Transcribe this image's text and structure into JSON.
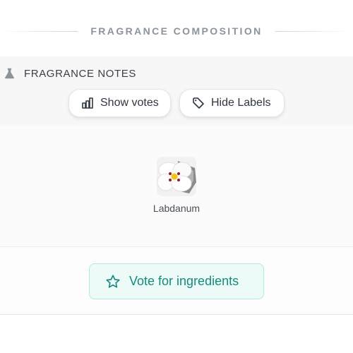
{
  "section": {
    "title": "FRAGRANCE COMPOSITION"
  },
  "notes": {
    "heading": "FRAGRANCE NOTES",
    "heading_icon": "flask-icon",
    "show_votes_label": "Show votes",
    "show_votes_icon": "bar-chart-icon",
    "hide_labels_label": "Hide Labels",
    "hide_labels_icon": "tag-icon",
    "ingredients": [
      {
        "name": "Labdanum",
        "image": "white-flower"
      }
    ]
  },
  "vote": {
    "label": "Vote for ingredients",
    "icon": "star-icon"
  },
  "colors": {
    "accent": "#178a7e",
    "vote_bg": "#ecfaf8",
    "vote_border": "#b3e8de"
  }
}
